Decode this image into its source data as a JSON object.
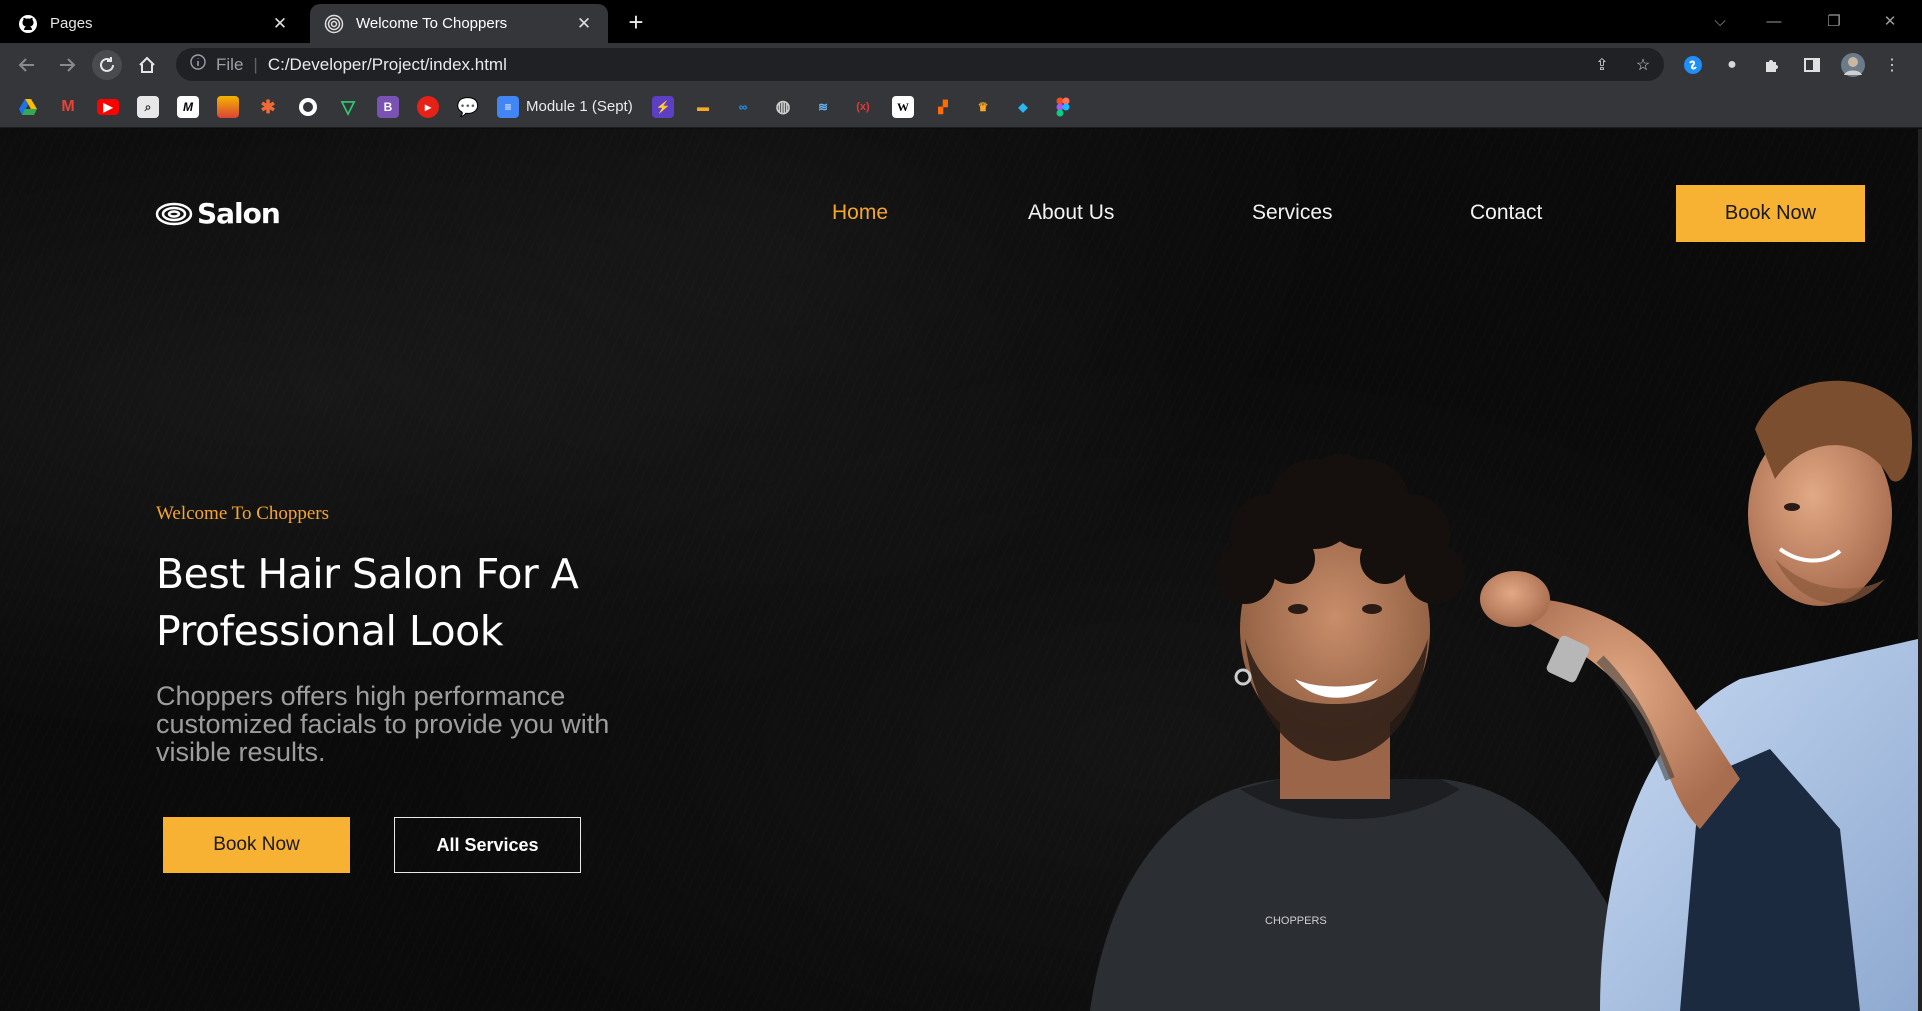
{
  "browser": {
    "tabs": [
      {
        "title": "Pages",
        "icon": "github-icon"
      },
      {
        "title": "Welcome To Choppers",
        "icon": "salon-logo-icon"
      }
    ],
    "address": {
      "scheme": "File",
      "url": "C:/Developer/Project/index.html"
    },
    "bookmarks": {
      "label": "Module 1 (Sept)"
    }
  },
  "site": {
    "logo_text": "Salon",
    "nav": {
      "home": "Home",
      "about": "About Us",
      "services": "Services",
      "contact": "Contact"
    },
    "cta_top": "Book Now"
  },
  "hero": {
    "eyebrow": "Welcome To Choppers",
    "headline": "Best Hair Salon For A Professional Look",
    "lead": "Choppers offers high performance customized facials to provide you with visible results.",
    "btn_primary": "Book Now",
    "btn_secondary": "All Services",
    "cape_logo": "CHOPPERS"
  },
  "colors": {
    "accent": "#f8b233",
    "background": "#0b0b0b",
    "text": "#ffffff"
  }
}
